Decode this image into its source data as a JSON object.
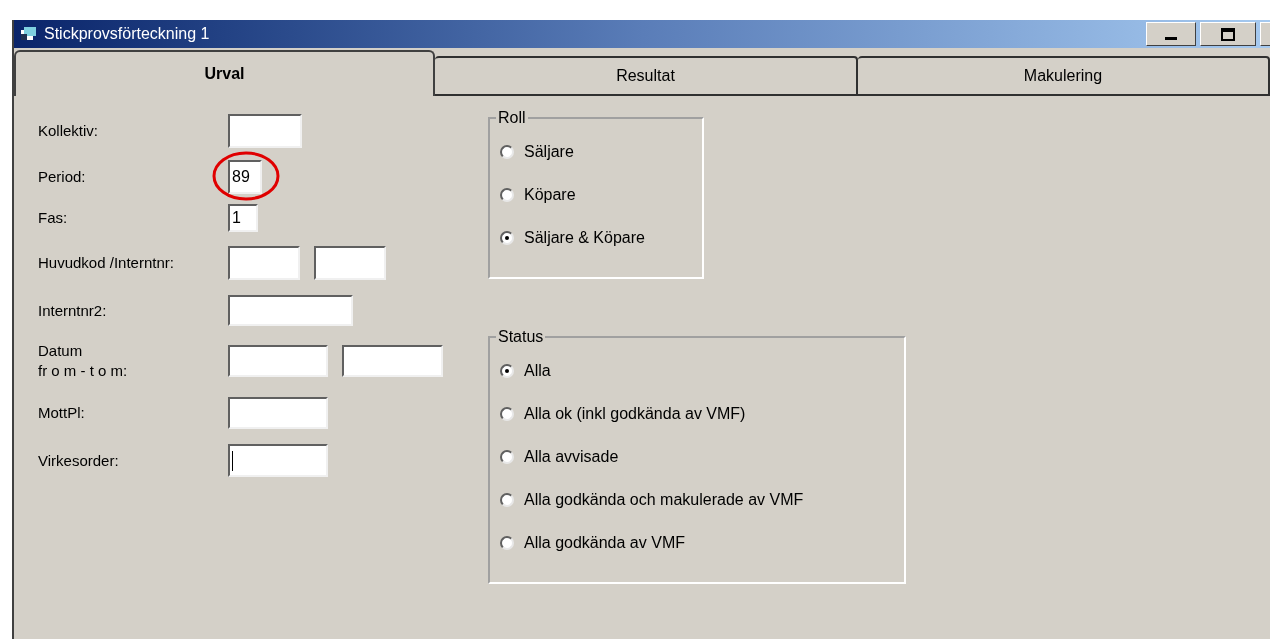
{
  "window": {
    "title": "Stickprovsförteckning 1"
  },
  "tabs": [
    {
      "label": "Urval",
      "selected": true
    },
    {
      "label": "Resultat",
      "selected": false
    },
    {
      "label": "Makulering",
      "selected": false
    }
  ],
  "fields": [
    {
      "label": "Kollektiv:",
      "inputs": [
        {
          "focused": false
        }
      ]
    },
    {
      "label": "Period:",
      "inputs": [
        {
          "value": "89",
          "circled": true,
          "focused": false
        }
      ]
    },
    {
      "label": "Fas:",
      "inputs": [
        {
          "value": "1",
          "focused": false
        }
      ]
    },
    {
      "label": "Huvudkod /Interntnr:",
      "inputs": [
        {
          "focused": false
        },
        {
          "focused": false
        }
      ]
    },
    {
      "label": "Interntnr2:",
      "inputs": [
        {
          "focused": false
        }
      ]
    },
    {
      "label": "Datum\nfr o m - t o m:",
      "inputs": [
        {
          "focused": false
        },
        {
          "focused": false
        }
      ]
    },
    {
      "label": "MottPl:",
      "inputs": [
        {
          "focused": false
        }
      ]
    },
    {
      "label": "Virkesorder:",
      "inputs": [
        {
          "focused": true
        }
      ]
    }
  ],
  "groups": [
    {
      "title": "Roll",
      "options": [
        {
          "label": "Säljare",
          "selected": false
        },
        {
          "label": "Köpare",
          "selected": false
        },
        {
          "label": "Säljare & Köpare",
          "selected": true
        }
      ]
    },
    {
      "title": "Status",
      "options": [
        {
          "label": "Alla",
          "selected": true
        },
        {
          "label": "Alla ok (inkl godkända av VMF)",
          "selected": false
        },
        {
          "label": "Alla avvisade",
          "selected": false
        },
        {
          "label": "Alla godkända och makulerade av VMF",
          "selected": false
        },
        {
          "label": "Alla godkända av VMF",
          "selected": false
        }
      ]
    }
  ]
}
